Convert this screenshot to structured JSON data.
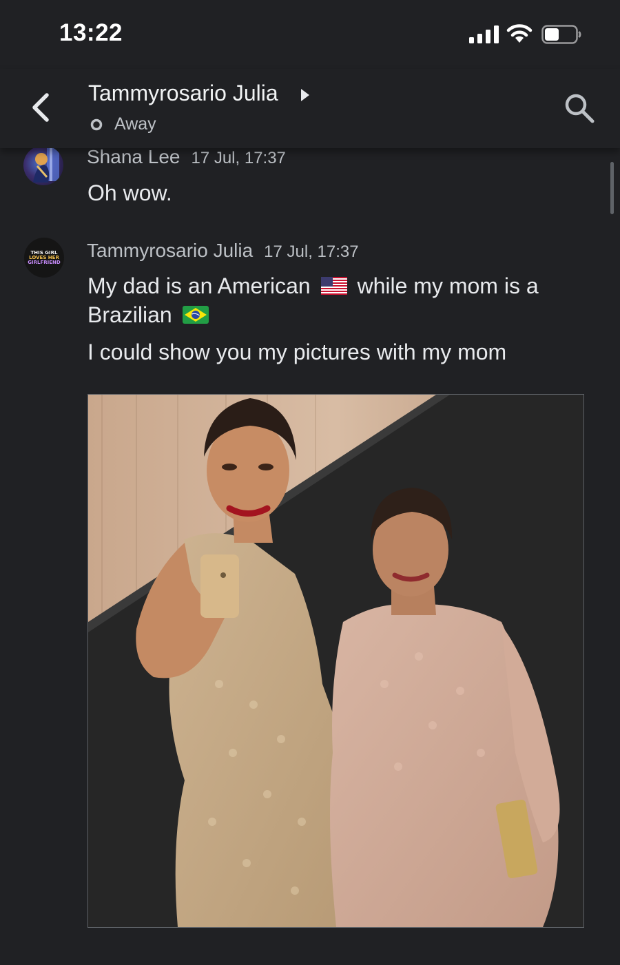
{
  "status_bar": {
    "time": "13:22",
    "icons": [
      "signal-bars-icon",
      "wifi-icon",
      "battery-icon"
    ]
  },
  "header": {
    "title": "Tammyrosario Julia",
    "presence": "Away",
    "icons": [
      "back-arrow-icon",
      "caret-right-icon",
      "search-icon"
    ]
  },
  "messages": [
    {
      "sender": "Shana Lee",
      "timestamp": "17 Jul, 17:37",
      "lines": [
        "Oh wow."
      ]
    },
    {
      "sender": "Tammyrosario Julia",
      "timestamp": "17 Jul, 17:37",
      "avatar_badge": [
        "THIS GIRL",
        "LOVES HER",
        "GIRLFRIEND"
      ],
      "line1_before_flag": "My dad is an American",
      "line1_after_flag": "while my mom is a",
      "line2": "Brazilian",
      "line3": "I could show you my pictures with my mom",
      "flags": [
        "us-flag-icon",
        "brazil-flag-icon"
      ]
    }
  ],
  "colors": {
    "background": "#202124",
    "text_primary": "#e8eaed",
    "text_secondary": "#bdc1c6"
  }
}
